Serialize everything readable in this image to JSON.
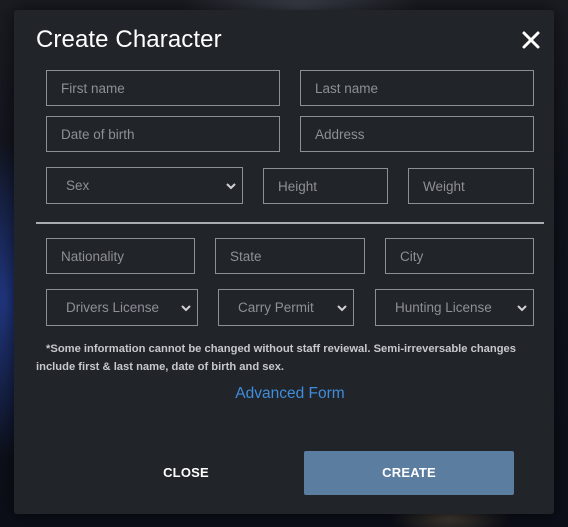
{
  "modal": {
    "title": "Create Character",
    "close_icon": "close-x-icon"
  },
  "personal": {
    "first_name": {
      "value": "",
      "placeholder": "First name"
    },
    "last_name": {
      "value": "",
      "placeholder": "Last name"
    },
    "date_of_birth": {
      "value": "",
      "placeholder": "Date of birth"
    },
    "address": {
      "value": "",
      "placeholder": "Address"
    },
    "sex": {
      "selected": "Sex"
    },
    "height": {
      "value": "",
      "placeholder": "Height"
    },
    "weight": {
      "value": "",
      "placeholder": "Weight"
    }
  },
  "origin": {
    "nationality": {
      "value": "",
      "placeholder": "Nationality"
    },
    "state": {
      "value": "",
      "placeholder": "State"
    },
    "city": {
      "value": "",
      "placeholder": "City"
    }
  },
  "licenses": {
    "drivers_license": {
      "selected": "Drivers License"
    },
    "carry_permit": {
      "selected": "Carry Permit"
    },
    "hunting_license": {
      "selected": "Hunting License"
    }
  },
  "notice": "*Some information cannot be changed without staff reviewal. Semi-irreversable changes include first & last name, date of birth and sex.",
  "advanced_form_link": "Advanced Form",
  "buttons": {
    "close": "CLOSE",
    "create": "CREATE"
  },
  "colors": {
    "modal_background": "#212429",
    "field_border": "#8b8f96",
    "link": "#3f8ddc",
    "create_button": "#5b7d9f"
  }
}
